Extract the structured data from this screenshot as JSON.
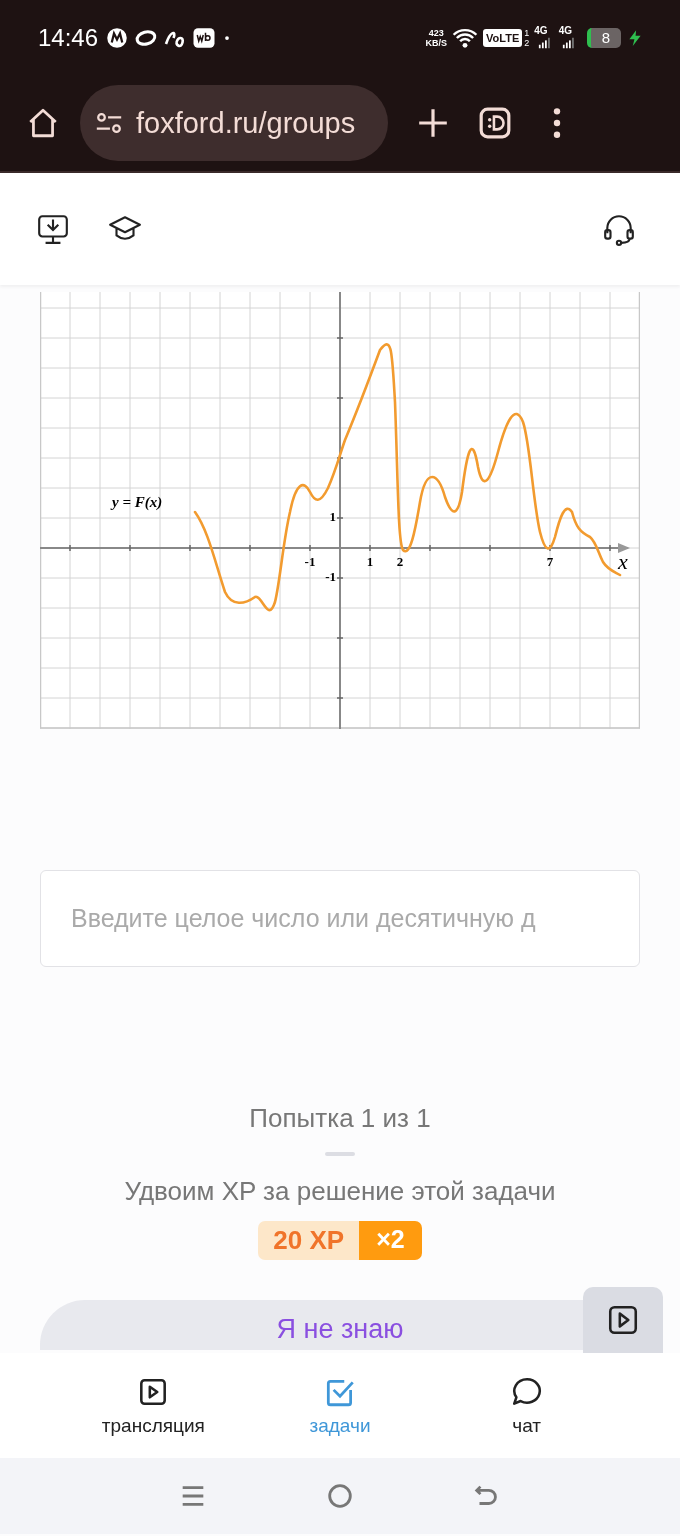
{
  "status_bar": {
    "time": "14:46",
    "speed": "423",
    "speed_unit": "KB/S",
    "volte": "VoLTE",
    "sim_1": "1",
    "sim_2": "2",
    "network_1": "4G",
    "network_2": "4G",
    "battery": "8"
  },
  "browser": {
    "url": "foxford.ru/groups"
  },
  "task": {
    "graph": {
      "function_label": "y = F(x)",
      "axis_label": "x",
      "x_ticks": [
        "-1",
        "1",
        "2",
        "7"
      ],
      "y_ticks": [
        "1",
        "-1"
      ]
    },
    "answer": {
      "placeholder": "Введите целое число или десятичную д"
    },
    "attempt": "Попытка 1 из 1",
    "bonus_text": "Удвоим XP за решение этой задачи",
    "xp": "20 XP",
    "multiplier": "×2",
    "dont_know_button": "Я не знаю"
  },
  "bottom_nav": [
    {
      "label": "трансляция",
      "selected": false
    },
    {
      "label": "задачи",
      "selected": true
    },
    {
      "label": "чат",
      "selected": false
    }
  ]
}
